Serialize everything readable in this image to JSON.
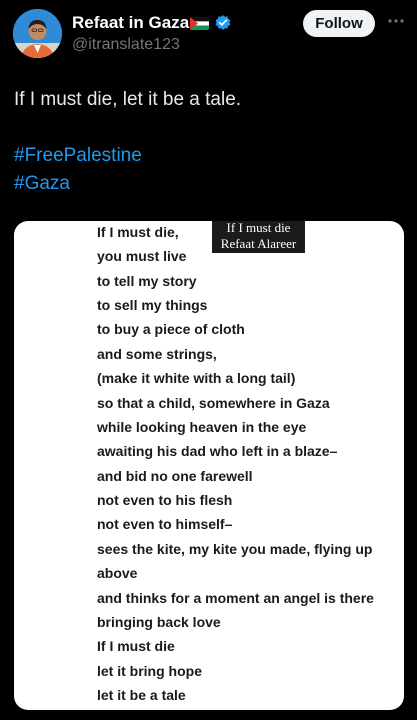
{
  "author": {
    "name": "Refaat in Gaza",
    "handle": "@itranslate123",
    "flag_icon": "palestine-flag-icon",
    "verified_icon": "verified-badge-icon"
  },
  "actions": {
    "follow_label": "Follow",
    "more_icon": "more-horizontal-icon"
  },
  "tweet": {
    "text": "If I must die, let it be a tale.",
    "hashtags": [
      "#FreePalestine",
      "#Gaza"
    ]
  },
  "media": {
    "caption": {
      "line1": "If I must die",
      "line2": "Refaat Alareer"
    },
    "poem": [
      "If I must die,",
      "you must live",
      "to tell my story",
      "to sell my things",
      "to buy a piece of cloth",
      "and some strings,",
      "(make it white with a long tail)",
      "so that a child, somewhere in Gaza",
      "while looking heaven in the eye",
      "awaiting his dad who left in a blaze–",
      "and bid no one farewell",
      "not even to his flesh",
      "not even to himself–",
      "sees the kite, my kite you made, flying up",
      "above",
      "and thinks for a moment an angel is there",
      "bringing back love",
      "If I must die",
      "let it bring hope",
      "let it be a tale"
    ]
  },
  "colors": {
    "background": "#000000",
    "text": "#e7e9ea",
    "secondary_text": "#71767b",
    "link": "#1d9bf0",
    "verified": "#1d9bf0",
    "follow_bg": "#eff3f4"
  }
}
